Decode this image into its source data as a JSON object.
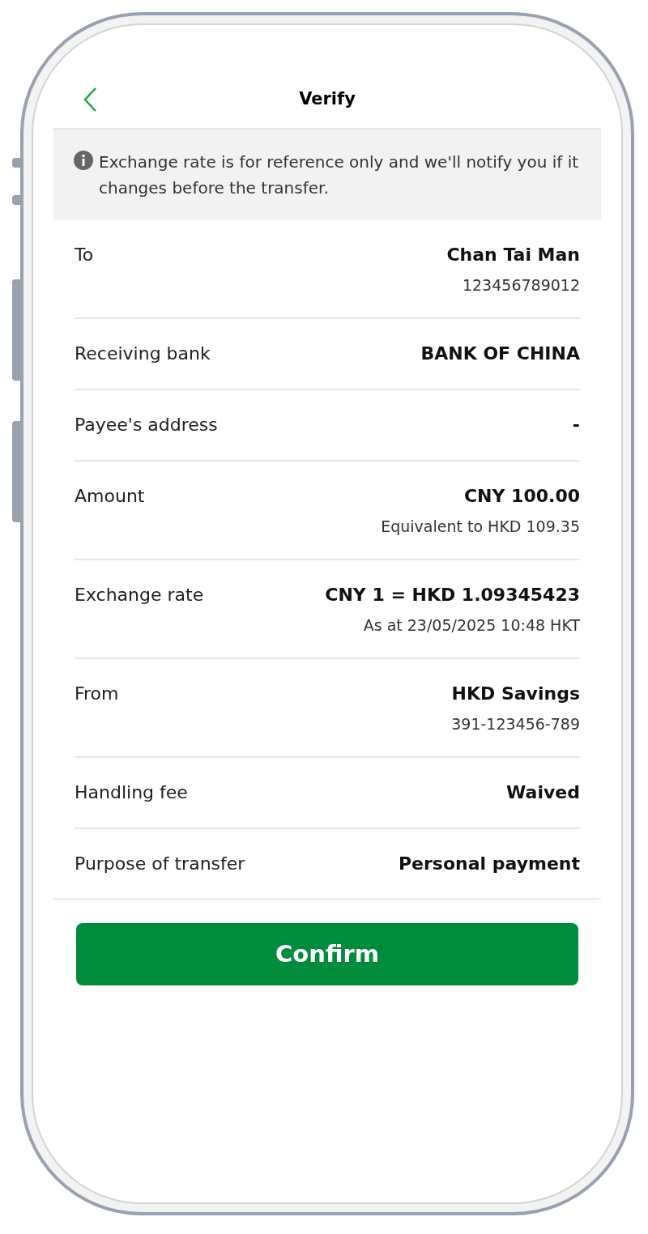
{
  "header": {
    "title": "Verify"
  },
  "notice": {
    "text": "Exchange rate is for reference only and we'll notify you if it changes before the transfer."
  },
  "details": [
    {
      "label": "To",
      "value": "Chan Tai Man",
      "sub": "123456789012"
    },
    {
      "label": "Receiving bank",
      "value": "BANK OF CHINA"
    },
    {
      "label": "Payee's address",
      "value": "-"
    },
    {
      "label": "Amount",
      "value": "CNY 100.00",
      "sub": "Equivalent to HKD 109.35"
    },
    {
      "label": "Exchange rate",
      "value": "CNY 1 = HKD 1.09345423",
      "sub": "As at 23/05/2025 10:48 HKT"
    },
    {
      "label": "From",
      "value": "HKD Savings",
      "sub": "391-123456-789"
    },
    {
      "label": "Handling fee",
      "value": "Waived"
    },
    {
      "label": "Purpose of transfer",
      "value": "Personal payment"
    }
  ],
  "confirm_button": {
    "label": "Confirm"
  }
}
